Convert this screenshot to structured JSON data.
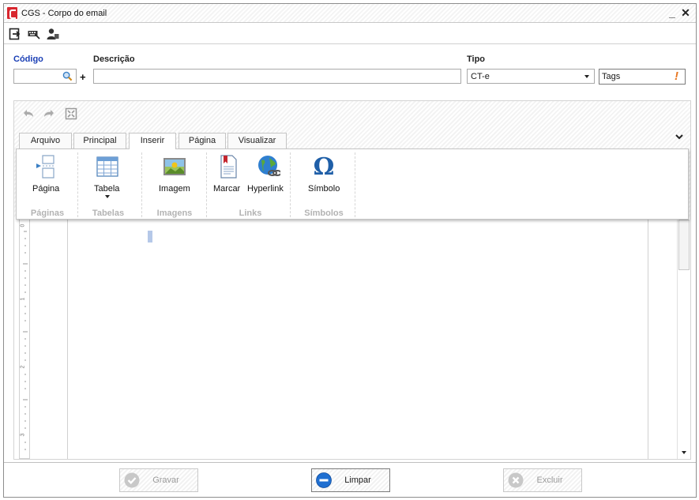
{
  "window": {
    "title": "CGS - Corpo do email",
    "minimize": "_",
    "close": "✕"
  },
  "toolbar": {
    "icons": [
      "exit-icon",
      "keyboard-icon",
      "user-icon"
    ]
  },
  "form": {
    "codigo_label": "Código",
    "codigo_value": "",
    "descricao_label": "Descrição",
    "descricao_value": "",
    "tipo_label": "Tipo",
    "tipo_value": "CT-e",
    "tags_label": "Tags",
    "plus": "+",
    "tags_alert": "!"
  },
  "editor": {
    "tabs": [
      {
        "label": "Arquivo"
      },
      {
        "label": "Principal"
      },
      {
        "label": "Inserir"
      },
      {
        "label": "Página"
      },
      {
        "label": "Visualizar"
      }
    ],
    "active_tab": "Inserir",
    "ribbon": {
      "buttons": [
        {
          "label": "Página",
          "icon": "page-break-icon"
        },
        {
          "label": "Tabela",
          "icon": "table-icon"
        },
        {
          "label": "Imagem",
          "icon": "image-icon"
        },
        {
          "label": "Marcar",
          "icon": "bookmark-icon"
        },
        {
          "label": "Hyperlink",
          "icon": "hyperlink-icon"
        },
        {
          "label": "Símbolo",
          "icon": "omega-icon"
        }
      ],
      "groups": [
        {
          "label": "Páginas"
        },
        {
          "label": "Tabelas"
        },
        {
          "label": "Imagens"
        },
        {
          "label": "Links"
        },
        {
          "label": "Símbolos"
        }
      ]
    },
    "ruler_marks": [
      "0",
      "1",
      "2",
      "3"
    ]
  },
  "footer": {
    "gravar": "Gravar",
    "limpar": "Limpar",
    "excluir": "Excluir"
  },
  "colors": {
    "accent_blue": "#1a3fb5",
    "app_red": "#d8262e",
    "tags_alert": "#e87722",
    "limpar_blue": "#1f6fd1"
  }
}
